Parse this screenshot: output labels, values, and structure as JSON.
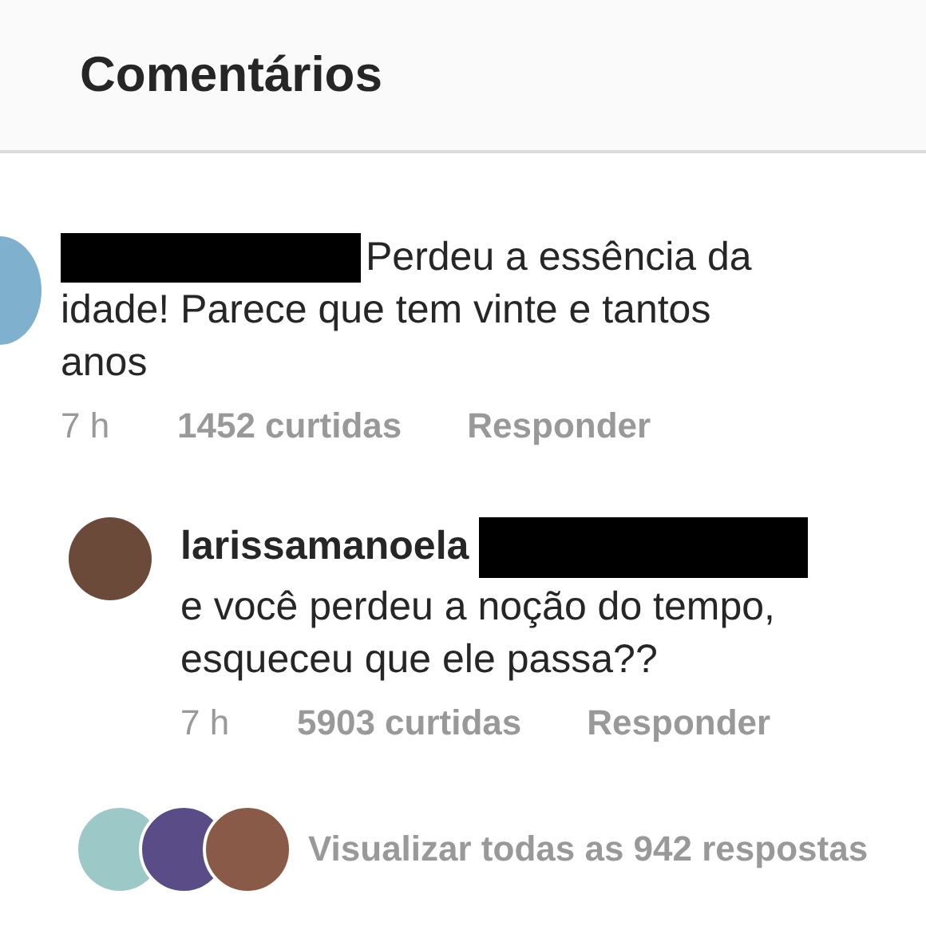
{
  "header": {
    "title": "Comentários"
  },
  "comment": {
    "redacted": true,
    "text": "Perdeu a essência da idade! Parece que tem vinte e tantos anos",
    "time": "7 h",
    "likes": "1452 curtidas",
    "reply_action": "Responder"
  },
  "reply": {
    "username": "larissamanoela",
    "redacted": true,
    "text": "e você perdeu a noção do tempo, esqueceu que ele passa??",
    "time": "7 h",
    "likes": "5903 curtidas",
    "reply_action": "Responder"
  },
  "view_replies": "Visualizar todas as 942 respostas"
}
